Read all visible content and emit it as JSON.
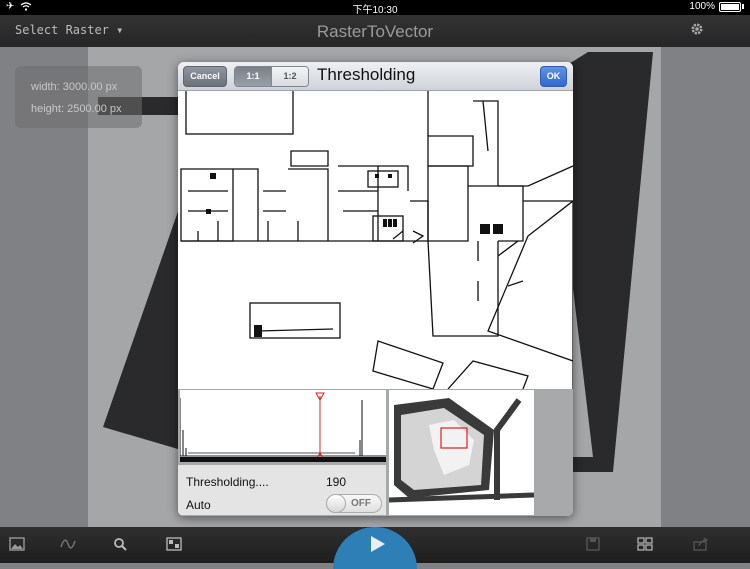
{
  "status_bar": {
    "time": "下午10:30",
    "battery": "100%"
  },
  "nav": {
    "left_button": "Select Raster ▾",
    "title": "RasterToVector"
  },
  "info": {
    "width": "width: 3000.00 px",
    "height": "height: 2500.00 px"
  },
  "dialog": {
    "cancel_label": "Cancel",
    "scale_options": [
      "1:1",
      "1:2"
    ],
    "selected_scale": "1:1",
    "title": "Thresholding",
    "ok_label": "OK",
    "threshold_label": "Thresholding....",
    "threshold_value": "190",
    "auto_label": "Auto",
    "auto_state": "OFF"
  },
  "colors": {
    "accent_blue": "#2f68cf",
    "play_blue": "#2e7fb5",
    "histogram_marker": "#e02020"
  },
  "toolbar": {
    "icons": [
      "image-icon",
      "wave-icon",
      "search-icon",
      "layers-icon",
      "play-icon",
      "save-icon",
      "grid-icon",
      "share-icon"
    ]
  }
}
